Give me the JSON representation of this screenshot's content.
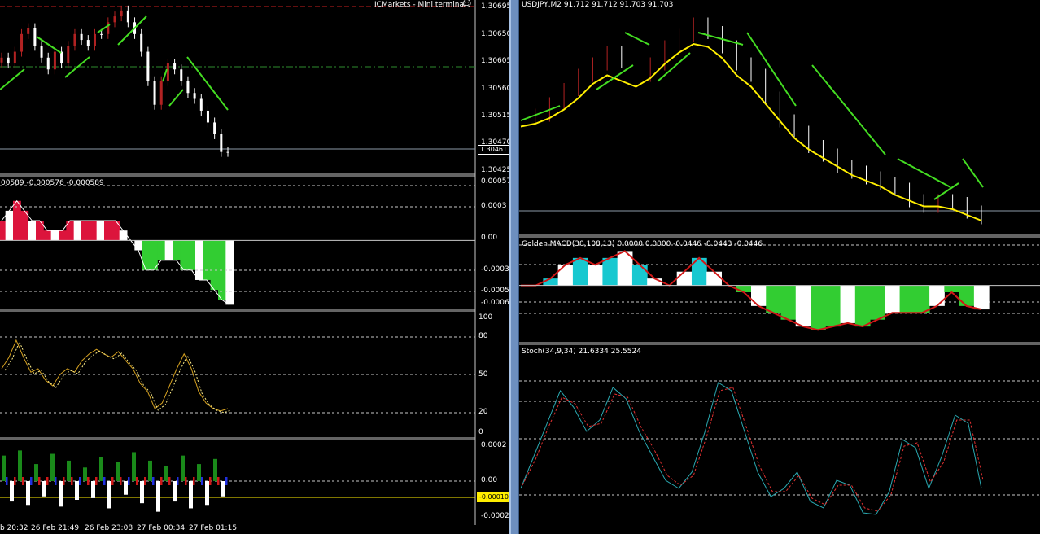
{
  "terminal_label": "ICMarkets - Mini terminal",
  "smiley_icon": "☺",
  "left": {
    "price_axis": [
      "1.30695",
      "1.30650",
      "1.30605",
      "1.30560",
      "1.30515",
      "1.30470",
      "1.30425"
    ],
    "current_price": "1.30461",
    "macd_label": "00589 -0.000576 -0.000589",
    "macd_axis": [
      "0.00057",
      "0.0003",
      "0.00",
      "-0.0003",
      "-0.0005",
      "-0.00065"
    ],
    "stoch_axis": [
      "100",
      "80",
      "50",
      "20",
      "0"
    ],
    "osc_axis": [
      "0.0002",
      "0.00",
      "-0.0001",
      "-0.0002"
    ],
    "osc_current": "-0.00010",
    "time_axis": [
      "b 20:32",
      "26 Feb 21:49",
      "26 Feb 23:08",
      "27 Feb 00:34",
      "27 Feb 01:15"
    ]
  },
  "right": {
    "chart_title": "USDJPY,M2  91.712 91.712 91.703 91.703",
    "macd_label": "Golden MACD(30,108,13) 0.0000 0.0000 -0.0446 -0.0443 -0.0446",
    "stoch_label": "Stoch(34,9,34) 21.6334 25.5524"
  },
  "colors": {
    "bull": "#b22222",
    "bear": "#ffffff",
    "ema_green": "#44dd22",
    "ma_yellow": "#ffee00",
    "macd_red": "#dc143c",
    "macd_green": "#32cd32",
    "cyan": "#18c8d0",
    "stoch_main": "#2aa8b0",
    "stoch_signal": "#e03030",
    "grid": "#c8c8c8",
    "separator": "#c8c8c8"
  },
  "chart_data": [
    {
      "type": "line",
      "title": "",
      "ylim": [
        1.30425,
        1.30715
      ],
      "series": [
        {
          "values": [
            1.3062,
            1.3061,
            1.3063,
            1.3066,
            1.3067,
            1.3064,
            1.3062,
            1.306,
            1.3063,
            1.3061,
            1.3064,
            1.3066,
            1.3065,
            1.3064,
            1.3066,
            1.3066,
            1.3068,
            1.3069,
            1.307,
            1.3068,
            1.3066,
            1.3063,
            1.3058,
            1.3054,
            1.3058,
            1.3061,
            1.306,
            1.3058,
            1.3056,
            1.3055,
            1.3053,
            1.3051,
            1.3049,
            1.3046,
            1.3046
          ]
        }
      ]
    },
    {
      "type": "area",
      "ylim": [
        -0.00068,
        0.00062
      ],
      "series": [
        {
          "values": [
            0.0002,
            0.0003,
            0.0004,
            0.0003,
            0.0002,
            0.0002,
            0.0001,
            0.0001,
            0.0001,
            0.0002,
            0.0002,
            0.0002,
            0.0002,
            0.0002,
            0.0002,
            0.0002,
            0.0001,
            0.0,
            -0.0001,
            -0.0003,
            -0.0003,
            -0.0002,
            -0.0002,
            -0.0002,
            -0.0003,
            -0.0003,
            -0.0004,
            -0.0004,
            -0.0005,
            -0.0006,
            -0.00065
          ]
        }
      ]
    },
    {
      "type": "line",
      "ylim": [
        0,
        100
      ],
      "series": [
        {
          "values": [
            55,
            65,
            80,
            65,
            52,
            55,
            45,
            40,
            50,
            55,
            52,
            62,
            68,
            72,
            68,
            65,
            70,
            62,
            55,
            42,
            35,
            20,
            25,
            40,
            55,
            68,
            55,
            35,
            25,
            20,
            18,
            20
          ]
        }
      ]
    },
    {
      "type": "bar",
      "ylim": [
        -0.00022,
        0.00022
      ],
      "series": [
        {
          "values": [
            0.00015,
            -0.00012,
            0.00018,
            -0.00014,
            0.0001,
            -9e-05,
            0.00016,
            -0.00015,
            0.00012,
            -0.00011,
            8e-05,
            -0.0001,
            0.00014,
            -0.00016,
            0.00011,
            -8e-05,
            0.00017,
            -0.00013,
            0.00012,
            -0.00018,
            9e-05,
            -0.00012,
            0.00015,
            -0.00016,
            0.0001,
            -0.00014,
            0.00013,
            -9e-05
          ]
        }
      ]
    },
    {
      "type": "line",
      "title": "USDJPY,M2",
      "ylim": [
        91.65,
        92.45
      ],
      "series": [
        {
          "values": [
            92.05,
            92.06,
            92.1,
            92.15,
            92.2,
            92.24,
            92.28,
            92.25,
            92.2,
            92.24,
            92.3,
            92.34,
            92.38,
            92.35,
            92.3,
            92.24,
            92.2,
            92.12,
            92.04,
            92.0,
            91.95,
            91.92,
            91.88,
            91.86,
            91.84,
            91.82,
            91.8,
            91.76,
            91.74,
            91.76,
            91.75,
            91.72,
            91.7
          ]
        },
        {
          "values": [
            92.04,
            92.05,
            92.07,
            92.1,
            92.14,
            92.19,
            92.22,
            92.2,
            92.18,
            92.21,
            92.26,
            92.3,
            92.33,
            92.32,
            92.28,
            92.22,
            92.18,
            92.12,
            92.06,
            92.0,
            91.96,
            91.93,
            91.9,
            91.87,
            91.85,
            91.83,
            91.8,
            91.78,
            91.76,
            91.76,
            91.75,
            91.73,
            91.71
          ]
        }
      ]
    },
    {
      "type": "area",
      "title": "Golden MACD(30,108,13)",
      "ylim": [
        -0.08,
        0.06
      ],
      "series": [
        {
          "values": [
            0.0,
            0.0,
            0.01,
            0.03,
            0.04,
            0.03,
            0.04,
            0.05,
            0.03,
            0.01,
            0.0,
            0.02,
            0.04,
            0.02,
            0.0,
            -0.01,
            -0.03,
            -0.04,
            -0.05,
            -0.06,
            -0.065,
            -0.06,
            -0.055,
            -0.06,
            -0.05,
            -0.04,
            -0.04,
            -0.04,
            -0.03,
            -0.01,
            -0.03,
            -0.035
          ]
        }
      ]
    },
    {
      "type": "line",
      "title": "Stoch(34,9,34)",
      "ylim": [
        0,
        100
      ],
      "series": [
        {
          "values": [
            20,
            40,
            60,
            80,
            70,
            55,
            62,
            82,
            75,
            55,
            40,
            25,
            20,
            30,
            55,
            85,
            80,
            55,
            30,
            15,
            20,
            30,
            12,
            8,
            25,
            22,
            5,
            4,
            18,
            50,
            45,
            20,
            40,
            65,
            60,
            20
          ]
        },
        {
          "values": [
            22,
            38,
            58,
            76,
            72,
            58,
            60,
            78,
            76,
            58,
            44,
            28,
            22,
            28,
            52,
            80,
            82,
            58,
            34,
            18,
            18,
            28,
            14,
            10,
            22,
            22,
            8,
            6,
            16,
            46,
            48,
            24,
            36,
            62,
            62,
            25
          ]
        }
      ]
    }
  ]
}
